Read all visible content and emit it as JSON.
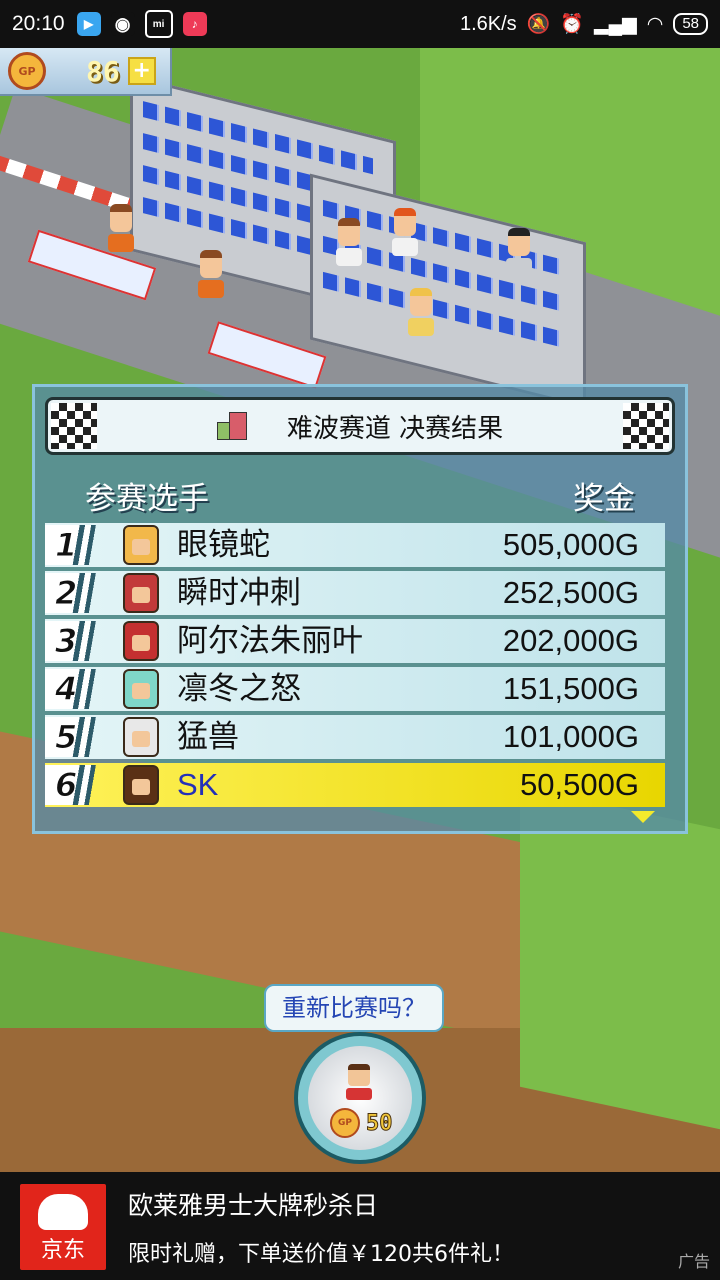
{
  "status_bar": {
    "time": "20:10",
    "network_speed": "1.6K/s",
    "battery": "58",
    "apps": [
      "play-store-icon",
      "weibo-icon",
      "mi-icon",
      "tiktok-icon"
    ]
  },
  "gp": {
    "value": "86",
    "coin_label": "GP",
    "plus": "+"
  },
  "results": {
    "title": "难波赛道 决赛结果",
    "col_player": "参赛选手",
    "col_prize": "奖金",
    "rows": [
      {
        "rank": "1",
        "name": "眼镜蛇",
        "prize": "505,000G",
        "avatar_color": "#f2b84a"
      },
      {
        "rank": "2",
        "name": "瞬时冲刺",
        "prize": "252,500G",
        "avatar_color": "#c23a3a"
      },
      {
        "rank": "3",
        "name": "阿尔法朱丽叶",
        "prize": "202,000G",
        "avatar_color": "#c43030"
      },
      {
        "rank": "4",
        "name": "凛冬之怒",
        "prize": "151,500G",
        "avatar_color": "#7fd6c8"
      },
      {
        "rank": "5",
        "name": "猛兽",
        "prize": "101,000G",
        "avatar_color": "#e8e8e8"
      },
      {
        "rank": "6",
        "name": "SK",
        "prize": "50,500G",
        "avatar_color": "#5a3015"
      }
    ]
  },
  "retry": {
    "question": "重新比赛吗？",
    "cost": "50",
    "coin_label": "GP"
  },
  "ad": {
    "brand": "京东",
    "title": "欧莱雅男士大牌秒杀日",
    "subtitle": "限时礼赠，下单送价值￥120共6件礼！",
    "label": "广告"
  }
}
